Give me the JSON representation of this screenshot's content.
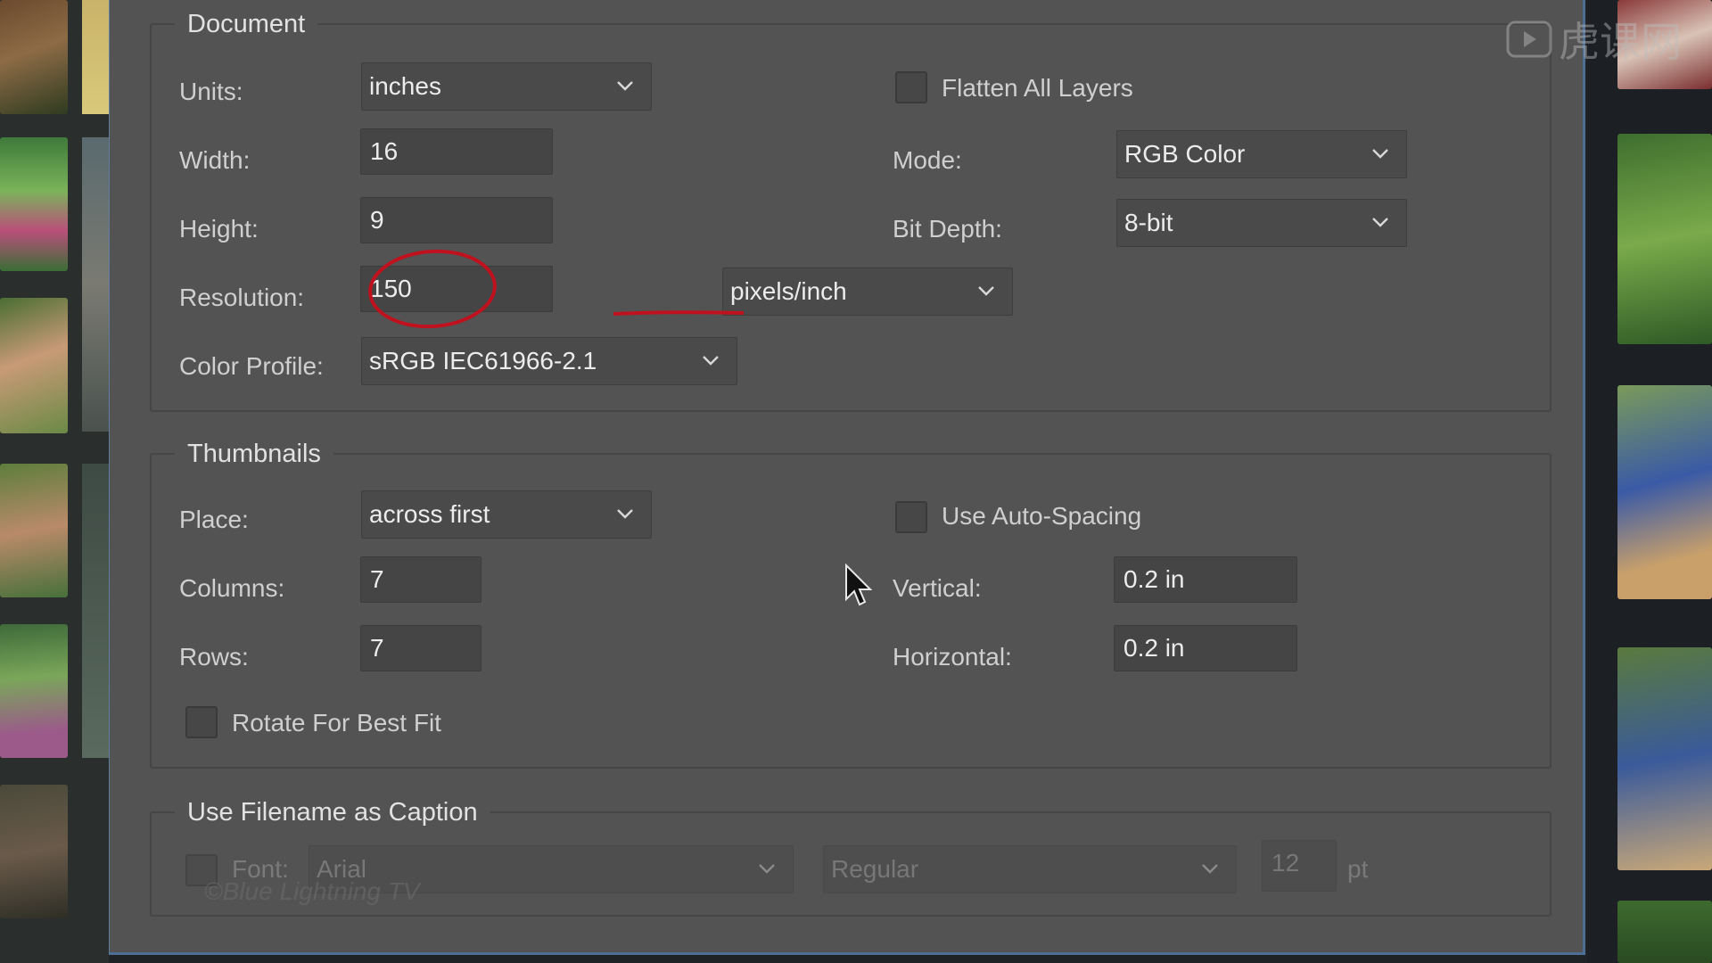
{
  "document": {
    "legend": "Document",
    "units_label": "Units:",
    "units_value": "inches",
    "width_label": "Width:",
    "width_value": "16",
    "height_label": "Height:",
    "height_value": "9",
    "resolution_label": "Resolution:",
    "resolution_value": "150",
    "resolution_unit": "pixels/inch",
    "color_profile_label": "Color Profile:",
    "color_profile_value": "sRGB IEC61966-2.1",
    "flatten_label": "Flatten All Layers",
    "flatten_checked": false,
    "mode_label": "Mode:",
    "mode_value": "RGB Color",
    "bit_depth_label": "Bit Depth:",
    "bit_depth_value": "8-bit"
  },
  "thumbnails": {
    "legend": "Thumbnails",
    "place_label": "Place:",
    "place_value": "across first",
    "columns_label": "Columns:",
    "columns_value": "7",
    "rows_label": "Rows:",
    "rows_value": "7",
    "rotate_label": "Rotate For Best Fit",
    "rotate_checked": false,
    "auto_spacing_label": "Use Auto-Spacing",
    "auto_spacing_checked": false,
    "vertical_label": "Vertical:",
    "vertical_value": "0.2 in",
    "horizontal_label": "Horizontal:",
    "horizontal_value": "0.2 in"
  },
  "caption": {
    "legend": "Use Filename as Caption",
    "font_label": "Font:",
    "font_value": "Arial",
    "style_value": "Regular",
    "size_value": "12",
    "size_unit": "pt",
    "enabled": false
  },
  "watermark": {
    "credit": "©Blue Lightning TV",
    "logo_text": "虎课网"
  },
  "colors": {
    "dialog_bg": "#535353",
    "annotation_red": "#c0121e",
    "frame_blue": "#4d6f95"
  }
}
